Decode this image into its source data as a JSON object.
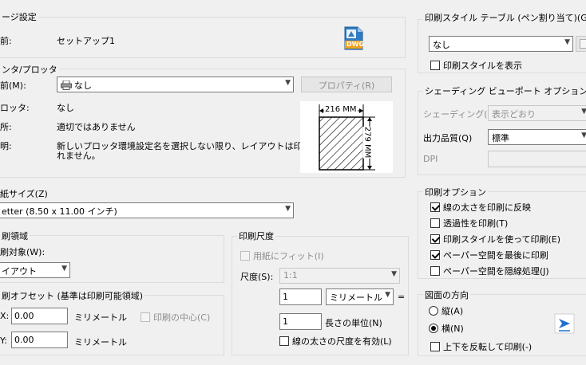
{
  "page_setup": {
    "title": "ージ設定",
    "name_label": "前:",
    "name_value": "セットアップ1",
    "file_icon_text": "DWG"
  },
  "printer": {
    "title": "ンタ/プロッタ",
    "name_label": "前(M):",
    "name_value": "なし",
    "properties_button": "プロパティ(R)",
    "plotter_label": "ロッタ:",
    "plotter_value": "なし",
    "where_label": "所:",
    "where_value": "適切ではありません",
    "desc_label": "明:",
    "desc_value_1": "新しいプロッタ環境設定名を選択しない限り、レイアウトは印刷さ",
    "desc_value_2": "れません。",
    "preview_width": "216 MM",
    "preview_height": "279 MM"
  },
  "paper_size": {
    "title": "紙サイズ(Z)",
    "value": "etter (8.50 x 11.00 インチ)"
  },
  "plot_area": {
    "title": "刷領域",
    "what_label": "刷対象(W):",
    "what_value": "イアウト"
  },
  "plot_offset": {
    "title": "刷オフセット (基準は印刷可能領域)",
    "x_label": "X:",
    "x_value": "0.00",
    "x_unit": "ミリメートル",
    "y_label": "Y:",
    "y_value": "0.00",
    "y_unit": "ミリメートル",
    "center_label": "印刷の中心(C)"
  },
  "plot_scale": {
    "title": "印刷尺度",
    "fit_label": "用紙にフィット(I)",
    "scale_label": "尺度(S):",
    "scale_value": "1:1",
    "value1": "1",
    "unit_value": "ミリメートル",
    "eq": "=",
    "value2": "1",
    "unit_label": "長さの単位(N)",
    "lineweights_label": "線の太さの尺度を有効(L)"
  },
  "plot_style_table": {
    "title": "印刷スタイル テーブル (ペン割り当て)(G)",
    "value": "なし",
    "display_label": "印刷スタイルを表示"
  },
  "shaded": {
    "title": "シェーディング ビューポート オプション",
    "shade_label": "シェーディング(D)",
    "shade_value": "表示どおり",
    "quality_label": "出力品質(Q)",
    "quality_value": "標準",
    "dpi_label": "DPI"
  },
  "plot_options": {
    "title": "印刷オプション",
    "opt1": "線の太さを印刷に反映",
    "opt2": "透過性を印刷(T)",
    "opt3": "印刷スタイルを使って印刷(E)",
    "opt4": "ペーパー空間を最後に印刷",
    "opt5": "ペーパー空間を隠線処理(J)"
  },
  "orientation": {
    "title": "図面の方向",
    "portrait": "縦(A)",
    "landscape": "横(N)",
    "upside_down": "上下を反転して印刷(-)"
  }
}
